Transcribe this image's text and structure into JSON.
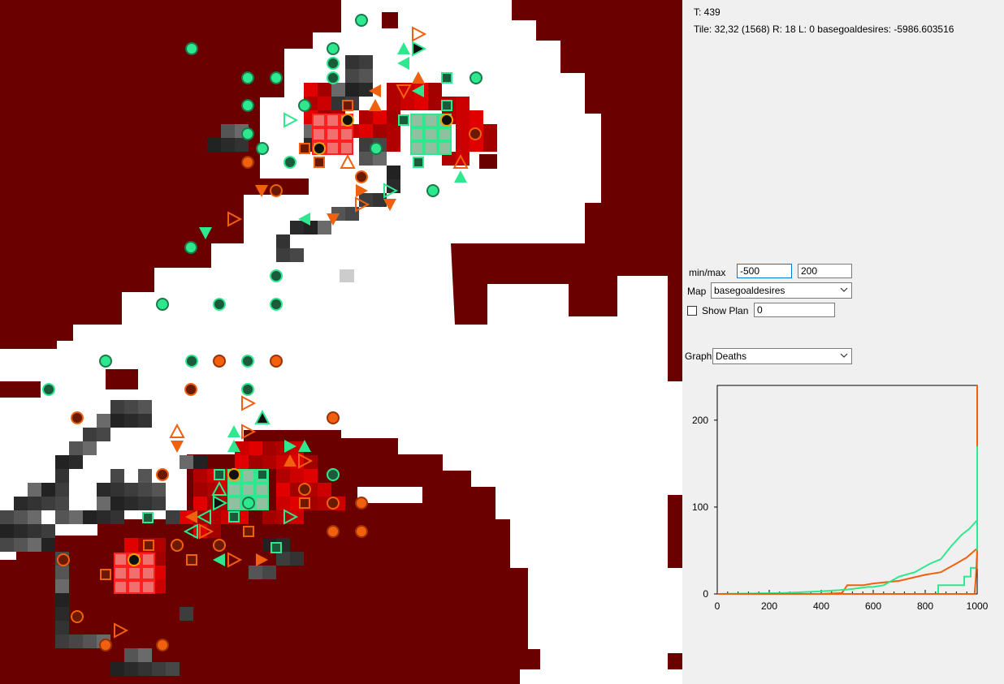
{
  "status": {
    "time_text": "T: 439",
    "tile_text": "Tile: 32,32 (1568)   R: 18 L: 0 basegoaldesires: -5986.603516"
  },
  "controls": {
    "minmax_label": "min/max",
    "min_value": "-500",
    "max_value": "200",
    "map_label": "Map",
    "map_selected": "basegoaldesires",
    "show_plan_label": "Show Plan",
    "show_plan_checked": false,
    "plan_value": "0",
    "graph_label": "Graph:",
    "graph_selected": "Deaths"
  },
  "colors": {
    "terrain": "#6b0000",
    "open": "#ffffff",
    "team_green": "#2ee88f",
    "team_orange": "#f0600f",
    "panel_bg": "#f0f0f0"
  },
  "chart_data": {
    "type": "line",
    "x_ticks": [
      "0",
      "200",
      "400",
      "600",
      "800",
      "1000"
    ],
    "y_ticks": [
      "0",
      "100",
      "200"
    ],
    "xlim": [
      0,
      1000
    ],
    "ylim": [
      0,
      240
    ],
    "series": [
      {
        "color": "#f0600f",
        "points": [
          [
            0,
            0
          ],
          [
            400,
            0
          ],
          [
            480,
            1
          ],
          [
            500,
            10
          ],
          [
            560,
            10
          ],
          [
            600,
            12
          ],
          [
            700,
            15
          ],
          [
            800,
            22
          ],
          [
            860,
            25
          ],
          [
            920,
            35
          ],
          [
            960,
            42
          ],
          [
            990,
            50
          ],
          [
            1000,
            52
          ],
          [
            1000,
            240
          ]
        ]
      },
      {
        "color": "#2ee88f",
        "points": [
          [
            0,
            0
          ],
          [
            250,
            1
          ],
          [
            400,
            3
          ],
          [
            500,
            5
          ],
          [
            580,
            8
          ],
          [
            600,
            8
          ],
          [
            640,
            10
          ],
          [
            700,
            20
          ],
          [
            760,
            25
          ],
          [
            820,
            35
          ],
          [
            860,
            40
          ],
          [
            900,
            55
          ],
          [
            940,
            68
          ],
          [
            970,
            75
          ],
          [
            1000,
            85
          ]
        ]
      },
      {
        "color": "#2ee88f",
        "points": [
          [
            0,
            0
          ],
          [
            850,
            0
          ],
          [
            850,
            10
          ],
          [
            950,
            10
          ],
          [
            950,
            20
          ],
          [
            975,
            20
          ],
          [
            975,
            30
          ],
          [
            1000,
            30
          ],
          [
            1000,
            170
          ]
        ]
      },
      {
        "color": "#f0600f",
        "points": [
          [
            0,
            0
          ],
          [
            990,
            0
          ],
          [
            995,
            20
          ],
          [
            1000,
            50
          ]
        ]
      }
    ]
  }
}
